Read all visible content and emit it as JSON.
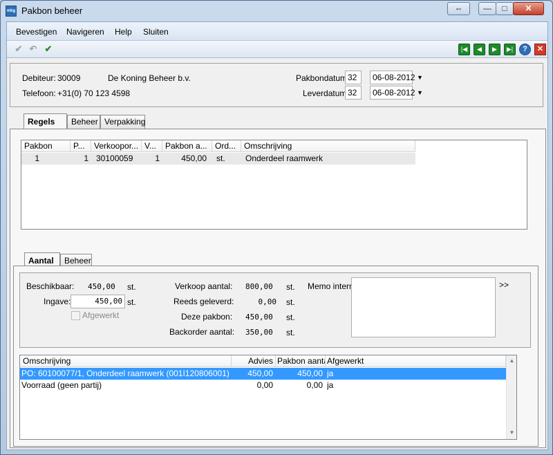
{
  "window": {
    "title": "Pakbon beheer",
    "app_icon_text": "mkg",
    "resize_glyph": "⇔",
    "minimize_glyph": "—",
    "maximize_glyph": "□",
    "close_glyph": "✕"
  },
  "menu": [
    "Bevestigen",
    "Navigeren",
    "Help",
    "Sluiten"
  ],
  "toolbar": {
    "icons": [
      "check-icon",
      "undo-icon",
      "confirm-all-icon"
    ],
    "nav": [
      "first-record-icon",
      "previous-record-icon",
      "next-record-icon",
      "last-record-icon"
    ],
    "help_glyph": "?",
    "close_glyph": "✕"
  },
  "header": {
    "debiteur_label": "Debiteur:",
    "debiteur_nr": "30009",
    "debiteur_naam": "De Koning Beheer b.v.",
    "telefoon_label": "Telefoon:",
    "telefoon": "+31(0) 70 123 4598",
    "pakbondatum_label": "Pakbondatum:",
    "pakbondatum_week": "32",
    "pakbondatum": "06-08-2012",
    "leverdatum_label": "Leverdatum:",
    "leverdatum_week": "32",
    "leverdatum": "06-08-2012"
  },
  "main_tabs": [
    "Regels",
    "Beheer",
    "Verpakking"
  ],
  "regels_grid": {
    "columns": [
      "Pakbon",
      "P...",
      "Verkoopor...",
      "V...",
      "Pakbon a...",
      "Ord...",
      "Omschrijving"
    ],
    "rows": [
      [
        "1",
        "1",
        "30100059",
        "1",
        "450,00",
        "st.",
        "Onderdeel raamwerk"
      ]
    ]
  },
  "sub_tabs": [
    "Aantal",
    "Beheer"
  ],
  "aantal": {
    "beschikbaar_label": "Beschikbaar:",
    "beschikbaar": "450,00",
    "beschikbaar_unit": "st.",
    "ingave_label": "Ingave:",
    "ingave": "450,00",
    "ingave_unit": "st.",
    "afgewerkt_label": "Afgewerkt",
    "verkoop_label": "Verkoop aantal:",
    "verkoop": "800,00",
    "verkoop_unit": "st.",
    "geleverd_label": "Reeds geleverd:",
    "geleverd": "0,00",
    "geleverd_unit": "st.",
    "deze_label": "Deze pakbon:",
    "deze": "450,00",
    "deze_unit": "st.",
    "backorder_label": "Backorder aantal:",
    "backorder": "350,00",
    "backorder_unit": "st.",
    "memo_label": "Memo intern:",
    "memo_expand": ">>"
  },
  "partij_grid": {
    "columns": [
      "Omschrijving",
      "Advies",
      "Pakbon aantal",
      "Afgewerkt"
    ],
    "rows": [
      [
        "PO: 60100077/1, Onderdeel raamwerk (001I120806001)",
        "450,00",
        "450,00",
        "ja"
      ],
      [
        "Voorraad (geen partij)",
        "0,00",
        "0,00",
        "ja"
      ]
    ],
    "selected_row": 0,
    "scroll_up": "▲",
    "scroll_down": "▼"
  },
  "colors": {
    "selection": "#3399ff",
    "nav_green": "#1f8a2a",
    "close_red": "#d33a2a"
  }
}
